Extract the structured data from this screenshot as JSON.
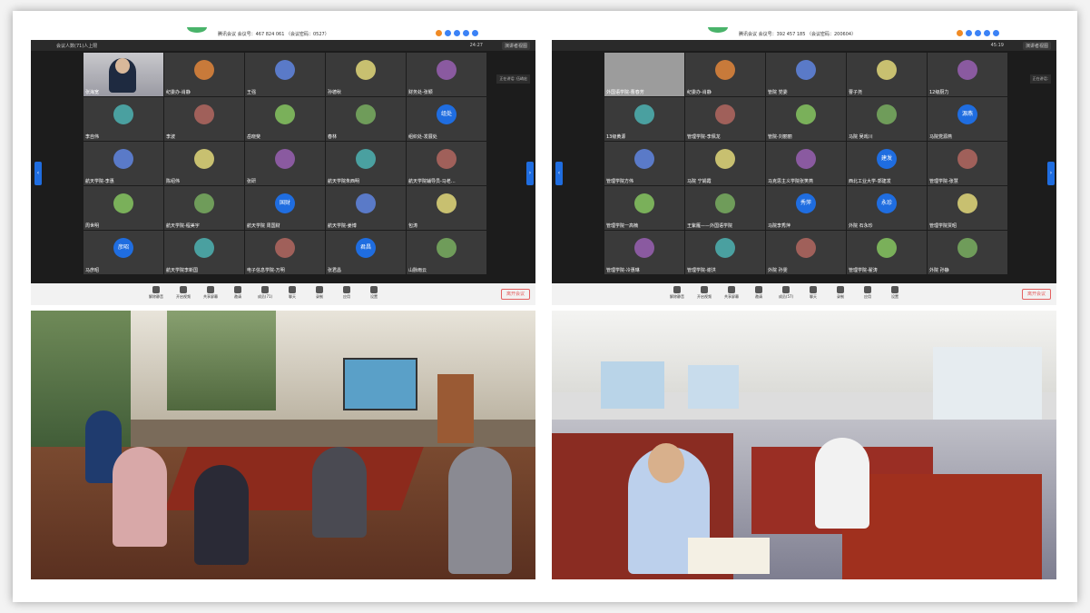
{
  "collage": {
    "left": {
      "window_title": "腾讯会议  会议号：467 824 061 （会议密码：0527）",
      "meeting_name": "会议人数(71)人上限",
      "time": "24:27",
      "layout_label": "演讲者视图",
      "side_note": "正在讲话: 伍峭宏",
      "participants": [
        {
          "name": "张海宽",
          "type": "video"
        },
        {
          "name": "纪委办-肖静",
          "avatar": ""
        },
        {
          "name": "王强",
          "avatar": ""
        },
        {
          "name": "孙德秋",
          "avatar": ""
        },
        {
          "name": "财务处-张颖",
          "avatar": ""
        },
        {
          "name": "李自伟",
          "avatar": ""
        },
        {
          "name": "李波",
          "avatar": ""
        },
        {
          "name": "岳晓斐",
          "avatar": ""
        },
        {
          "name": "春林",
          "avatar": ""
        },
        {
          "name": "组织处-发展处",
          "avatar": "组处"
        },
        {
          "name": "航天学院-李惠",
          "avatar": ""
        },
        {
          "name": "陈绍伟",
          "avatar": ""
        },
        {
          "name": "张研",
          "avatar": ""
        },
        {
          "name": "航天学院朱西明",
          "avatar": ""
        },
        {
          "name": "航天学院辅导员-马老…",
          "avatar": ""
        },
        {
          "name": "周世明",
          "avatar": ""
        },
        {
          "name": "航天学院-程美宇",
          "avatar": ""
        },
        {
          "name": "航天学院 周国财",
          "avatar": "国财"
        },
        {
          "name": "航天学院-姜博",
          "avatar": ""
        },
        {
          "name": "包涛",
          "avatar": ""
        },
        {
          "name": "马彦昭",
          "avatar": "彦昭"
        },
        {
          "name": "航天学院李新国",
          "avatar": ""
        },
        {
          "name": "电子信息学院-万明",
          "avatar": ""
        },
        {
          "name": "张君昌",
          "avatar": "君昌"
        },
        {
          "name": "山脉雨云",
          "avatar": ""
        }
      ],
      "toolbar": [
        "解除静音",
        "开启视频",
        "共享屏幕",
        "邀请",
        "成员(71)",
        "聊天",
        "录制",
        "应用",
        "设置"
      ],
      "leave_button": "离开会议"
    },
    "right": {
      "window_title": "腾讯会议  会议号：392 457 185 （会议密码：200604）",
      "time": "45:19",
      "layout_label": "演讲者视图",
      "side_note": "正在讲话: ",
      "participants": [
        {
          "name": "外国语学院-曹春芳",
          "type": "gray"
        },
        {
          "name": "纪委办-肖静",
          "avatar": ""
        },
        {
          "name": "管院 党委",
          "avatar": ""
        },
        {
          "name": "曹子尧",
          "avatar": ""
        },
        {
          "name": "12级厨力",
          "avatar": ""
        },
        {
          "name": "13级黄源",
          "avatar": ""
        },
        {
          "name": "管理学院-李佩龙",
          "avatar": ""
        },
        {
          "name": "管院-刘丽丽",
          "avatar": ""
        },
        {
          "name": "马院 吴戏川",
          "avatar": ""
        },
        {
          "name": "马院党源燕",
          "avatar": "源燕"
        },
        {
          "name": "管理学院方伟",
          "avatar": ""
        },
        {
          "name": "马院 宁娟霞",
          "avatar": ""
        },
        {
          "name": "马克思主义学院张笑燕",
          "avatar": ""
        },
        {
          "name": "西北工业大学-郭建发",
          "avatar": "建发"
        },
        {
          "name": "管理学院-张慧",
          "avatar": ""
        },
        {
          "name": "管理学院一高楠",
          "avatar": ""
        },
        {
          "name": "王紫雁——外国语学院",
          "avatar": ""
        },
        {
          "name": "马院李秀萍",
          "avatar": "秀萍"
        },
        {
          "name": "外院 石永珍",
          "avatar": "永珍"
        },
        {
          "name": "管理学院贾昭",
          "avatar": ""
        },
        {
          "name": "管理学院-冷惠琳",
          "avatar": ""
        },
        {
          "name": "管理学院-谢洪",
          "avatar": ""
        },
        {
          "name": "外院 孙雯",
          "avatar": ""
        },
        {
          "name": "管理学院-翟涛",
          "avatar": ""
        },
        {
          "name": "外院 孙静",
          "avatar": ""
        }
      ],
      "toolbar": [
        "解除静音",
        "开启视频",
        "共享屏幕",
        "邀请",
        "成员(57)",
        "聊天",
        "录制",
        "应用",
        "设置"
      ],
      "leave_button": "离开会议"
    }
  },
  "colors": {
    "accent": "#1f6de0",
    "leave": "#e46060",
    "window_bg": "#1c1c1c"
  }
}
